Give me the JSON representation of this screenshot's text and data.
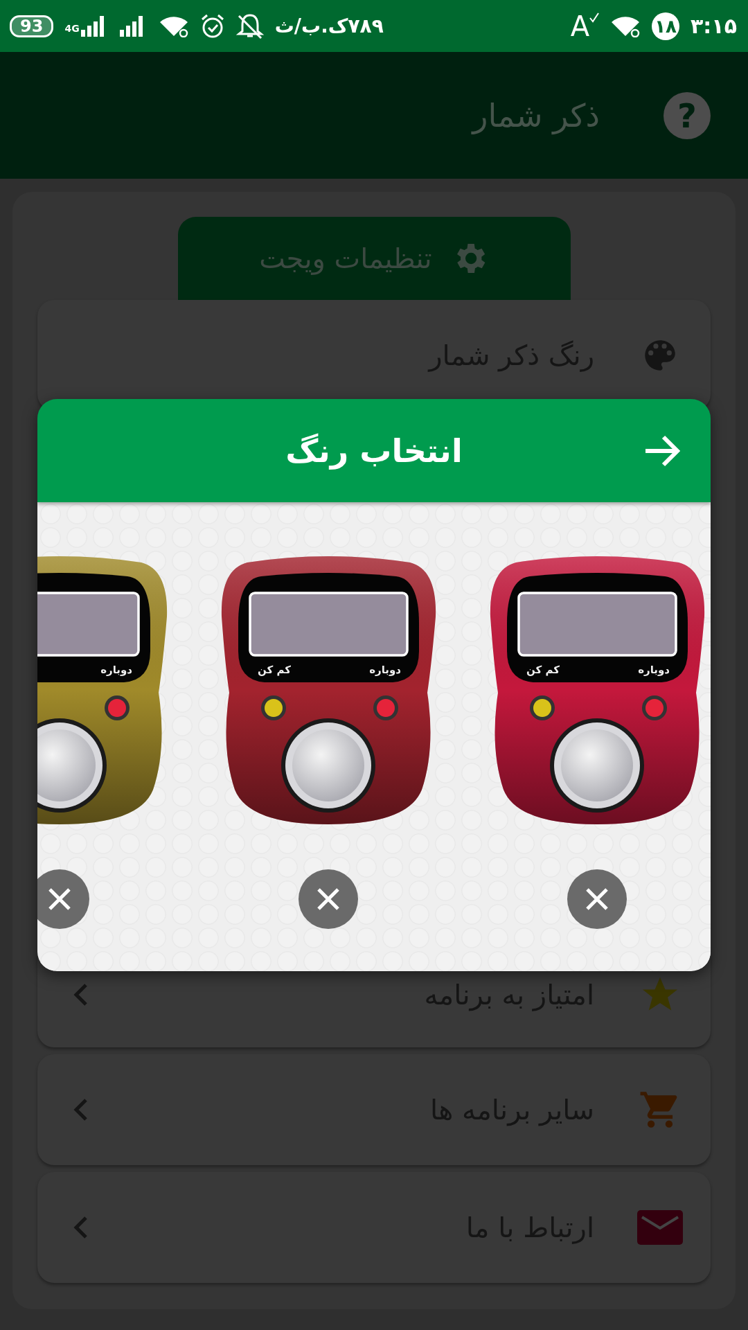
{
  "status_bar": {
    "battery": "93",
    "network_type": "4G",
    "speed": "۷۸۹ک.ب/ث",
    "text_icon": "A",
    "notification_count": "۱۸",
    "time": "۳:۱۵"
  },
  "app_bar": {
    "title": "ذکر شمار",
    "help": "?"
  },
  "settings_tab": {
    "label": "تنظیمات ویجت"
  },
  "menu_items": [
    {
      "kind": "palette",
      "label": "رنگ ذکر شمار"
    },
    {
      "kind": "star",
      "label": "امتیاز به برنامه"
    },
    {
      "kind": "cart",
      "label": "سایر برنامه ها"
    },
    {
      "kind": "mail",
      "label": "ارتباط با ما"
    }
  ],
  "dialog": {
    "title": "انتخاب رنگ",
    "counters": [
      {
        "color": "#c4183c",
        "labels": [
          "دوباره",
          "کم کن"
        ]
      },
      {
        "color": "#a3232e",
        "labels": [
          "دوباره",
          "کم کن"
        ]
      },
      {
        "color": "#a08a2a",
        "labels": [
          "دوباره"
        ]
      }
    ]
  }
}
